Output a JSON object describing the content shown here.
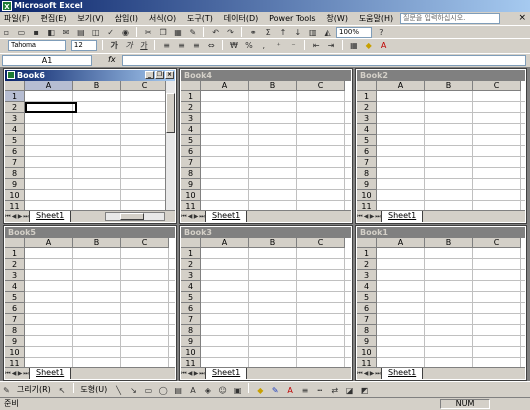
{
  "app": {
    "title": "Microsoft Excel",
    "logo": "X"
  },
  "menu": [
    {
      "label": "파일(F)"
    },
    {
      "label": "편집(E)"
    },
    {
      "label": "보기(V)"
    },
    {
      "label": "삽입(I)"
    },
    {
      "label": "서식(O)"
    },
    {
      "label": "도구(T)"
    },
    {
      "label": "데이터(D)"
    },
    {
      "label": "Power Tools"
    },
    {
      "label": "창(W)"
    },
    {
      "label": "도움말(H)"
    }
  ],
  "help": {
    "placeholder": "질문을 입력하십시오."
  },
  "close_glyph": "×",
  "toolbar": {
    "zoom": "100%"
  },
  "format": {
    "font": "Tahoma",
    "size": "12"
  },
  "formula": {
    "cell_ref": "A1",
    "fx": "fx",
    "value": ""
  },
  "columns": [
    "A",
    "B",
    "C"
  ],
  "rows": [
    "1",
    "2",
    "3",
    "4",
    "5",
    "6",
    "7",
    "8",
    "9",
    "10",
    "11"
  ],
  "workbooks": [
    {
      "title": "Book6",
      "sheet": "Sheet1",
      "active": true
    },
    {
      "title": "Book4",
      "sheet": "Sheet1",
      "active": false
    },
    {
      "title": "Book2",
      "sheet": "Sheet1",
      "active": false
    },
    {
      "title": "Book5",
      "sheet": "Sheet1",
      "active": false
    },
    {
      "title": "Book3",
      "sheet": "Sheet1",
      "active": false
    },
    {
      "title": "Book1",
      "sheet": "Sheet1",
      "active": false
    }
  ],
  "drawbar": {
    "draw": "그리기(R)",
    "shapes": "도형(U)"
  },
  "status": {
    "ready": "준비",
    "num": "NUM"
  },
  "colors": {
    "title_start": "#0a246a",
    "title_end": "#a6caf0",
    "chrome": "#d4d0c8",
    "workspace": "#808080",
    "excel_green": "#1e7b34"
  }
}
